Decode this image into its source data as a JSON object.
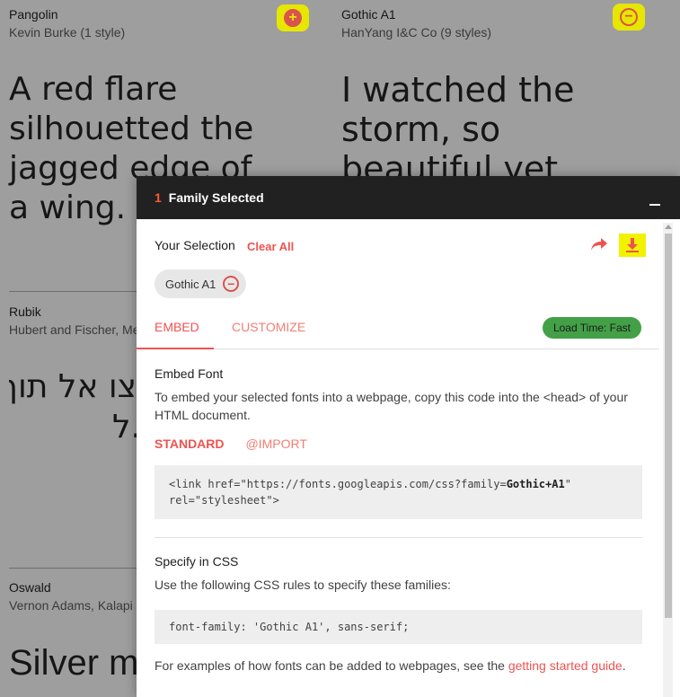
{
  "cards": [
    {
      "name": "Pangolin",
      "author": "Kevin Burke (1 style)",
      "sample": "A red flare silhouetted the jagged edge of a wing."
    },
    {
      "name": "Gothic A1",
      "author": "HanYang I&C Co (9 styles)",
      "sample": "I watched the storm, so beautiful yet"
    },
    {
      "name": "Rubik",
      "author": "Hubert and Fischer, Me",
      "sample": "צו אל תוך",
      "sample2": "ל."
    },
    {
      "name": "Oswald",
      "author": "Vernon Adams, Kalapi",
      "sample": "Silver mis"
    }
  ],
  "drawer": {
    "count": "1",
    "header_title": "Family Selected",
    "your_selection": "Your Selection",
    "clear_all": "Clear All",
    "chip_label": "Gothic A1",
    "tabs": {
      "embed": "EMBED",
      "customize": "CUSTOMIZE"
    },
    "load_time": "Load Time: Fast",
    "embed_title": "Embed Font",
    "embed_desc": "To embed your selected fonts into a webpage, copy this code into the <head> of your HTML document.",
    "sub_tabs": {
      "standard": "STANDARD",
      "import": "@IMPORT"
    },
    "code_link_pre": "<link href=\"https://fonts.googleapis.com/css?family=",
    "code_link_family": "Gothic+A1",
    "code_link_post": "\" rel=\"stylesheet\">",
    "css_title": "Specify in CSS",
    "css_desc": "Use the following CSS rules to specify these families:",
    "css_code": "font-family: 'Gothic A1', sans-serif;",
    "examples_pre": "For examples of how fonts can be added to webpages, see the ",
    "examples_link": "getting started guide",
    "examples_post": "."
  },
  "colors": {
    "accent": "#ef5350",
    "highlight": "#e6e600",
    "badge": "#43a047",
    "header_bg": "#212121"
  },
  "icons": [
    "add-circle-icon",
    "remove-circle-icon",
    "share-icon",
    "download-icon",
    "minimize-icon"
  ]
}
